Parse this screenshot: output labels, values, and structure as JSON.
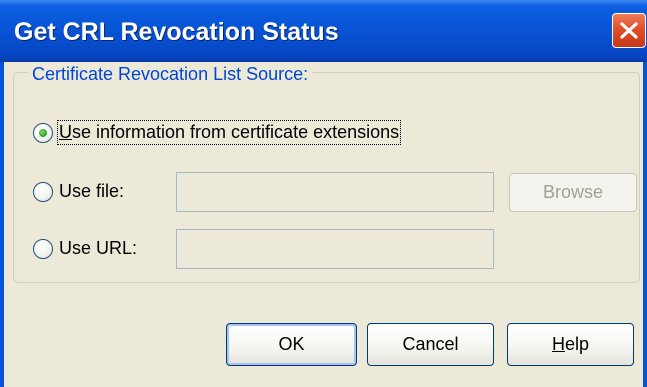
{
  "window": {
    "title": "Get CRL Revocation Status"
  },
  "group": {
    "legend": "Certificate Revocation List Source:"
  },
  "options": {
    "cert_ext": {
      "pre": "",
      "mnemonic": "U",
      "post": "se information from certificate extensions",
      "selected": true
    },
    "file": {
      "label": "Use file:",
      "selected": false
    },
    "url": {
      "label": "Use URL:",
      "selected": false
    }
  },
  "fields": {
    "file_value": "",
    "url_value": ""
  },
  "buttons": {
    "browse": "Browse",
    "ok": "OK",
    "cancel": "Cancel",
    "help_mnemonic": "H",
    "help_rest": "elp"
  },
  "icons": {
    "close": "close-icon",
    "radio_selected": "radio-selected-icon",
    "radio_unselected": "radio-unselected-icon"
  },
  "colors": {
    "titlebar": "#0853d4",
    "legend_text": "#0046d5",
    "dialog_bg": "#ece9d8",
    "close_button": "#e0502a"
  }
}
